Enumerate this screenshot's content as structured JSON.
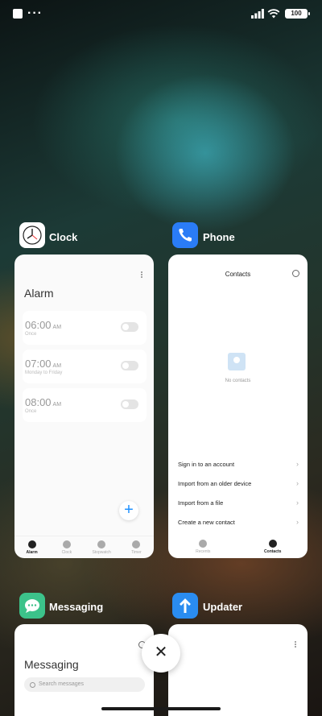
{
  "status_bar": {
    "dots": "···",
    "battery": "100"
  },
  "apps": {
    "clock": {
      "name": "Clock",
      "screen_title": "Alarm",
      "alarms": [
        {
          "time": "06:00",
          "ampm": "AM",
          "note": "Once"
        },
        {
          "time": "07:00",
          "ampm": "AM",
          "note": "Monday to Friday"
        },
        {
          "time": "08:00",
          "ampm": "AM",
          "note": "Once"
        }
      ],
      "tabs": [
        "Alarm",
        "Clock",
        "Stopwatch",
        "Timer"
      ],
      "add_label": "+"
    },
    "phone": {
      "name": "Phone",
      "screen_title": "Contacts",
      "empty_text": "No contacts",
      "options": [
        "Sign in to an account",
        "Import from an older device",
        "Import from a file",
        "Create a new contact"
      ],
      "tabs": [
        "Recents",
        "Contacts"
      ]
    },
    "messaging": {
      "name": "Messaging",
      "screen_title": "Messaging",
      "search_placeholder": "Search messages"
    },
    "updater": {
      "name": "Updater"
    }
  },
  "close_label": "✕",
  "colors": {
    "accent": "#1e90ff",
    "clock_icon_bg": "#ffffff",
    "phone_icon_bg": "#2a7cf6",
    "messaging_icon_bg": "#3cc28a",
    "updater_icon_bg": "#2a8cf0"
  }
}
